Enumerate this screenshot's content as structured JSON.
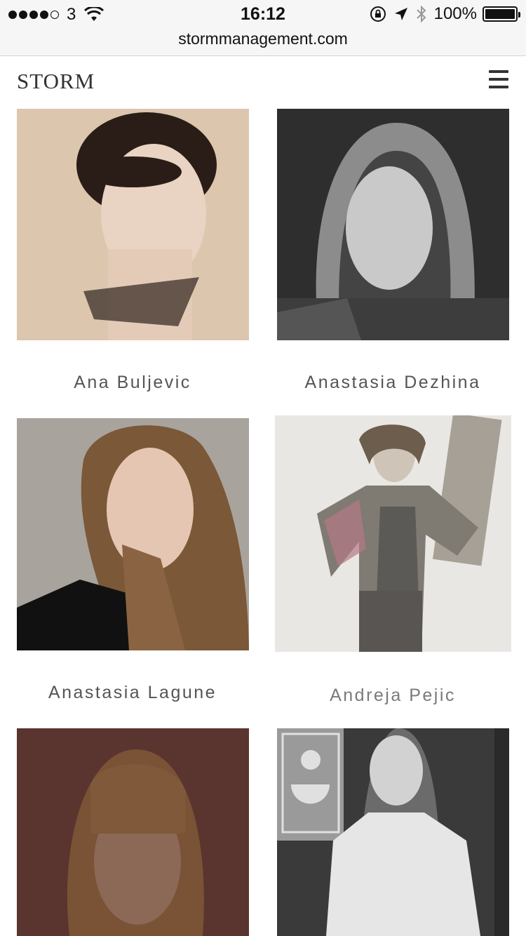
{
  "status_bar": {
    "carrier": "3",
    "time": "16:12",
    "battery": "100%",
    "battery_level": 1.0
  },
  "browser": {
    "url": "stormmanagement.com"
  },
  "header": {
    "logo": "STORM",
    "menu_icon": "hamburger-icon"
  },
  "models": [
    {
      "name": "Ana Buljevic"
    },
    {
      "name": "Anastasia Dezhina"
    },
    {
      "name": "Anastasia Lagune"
    },
    {
      "name": "Andreja Pejic"
    },
    {
      "name": ""
    },
    {
      "name": ""
    }
  ],
  "colors": {
    "text": "#555555",
    "background": "#ffffff"
  }
}
